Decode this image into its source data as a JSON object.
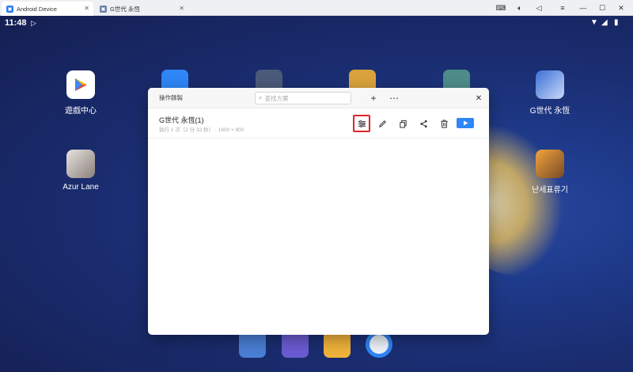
{
  "window": {
    "tabs": [
      {
        "label": "Android Device",
        "active": true
      },
      {
        "label": "G世代 永恆",
        "active": false
      }
    ]
  },
  "android": {
    "status": {
      "time": "11:48"
    },
    "apps": [
      {
        "label": "遊戲中心",
        "icon": "play-store-icon"
      },
      {
        "label": "G世代 永恆",
        "icon": "g-generation-icon"
      },
      {
        "label": "Azur Lane",
        "icon": "azur-lane-icon"
      },
      {
        "label": "난세표류기",
        "icon": "nanse-icon"
      }
    ],
    "dock": [
      "settings-icon",
      "gallery-icon",
      "files-icon",
      "camera-icon"
    ]
  },
  "dialog": {
    "title": "操作錄製",
    "search_placeholder": "查找方案",
    "script": {
      "name": "G世代 永恆(1)",
      "meta": "執行 1 次（2 分 32 秒）  ·  1600 × 900"
    }
  },
  "colors": {
    "accent": "#2f86f6",
    "highlight": "#e0232b"
  }
}
